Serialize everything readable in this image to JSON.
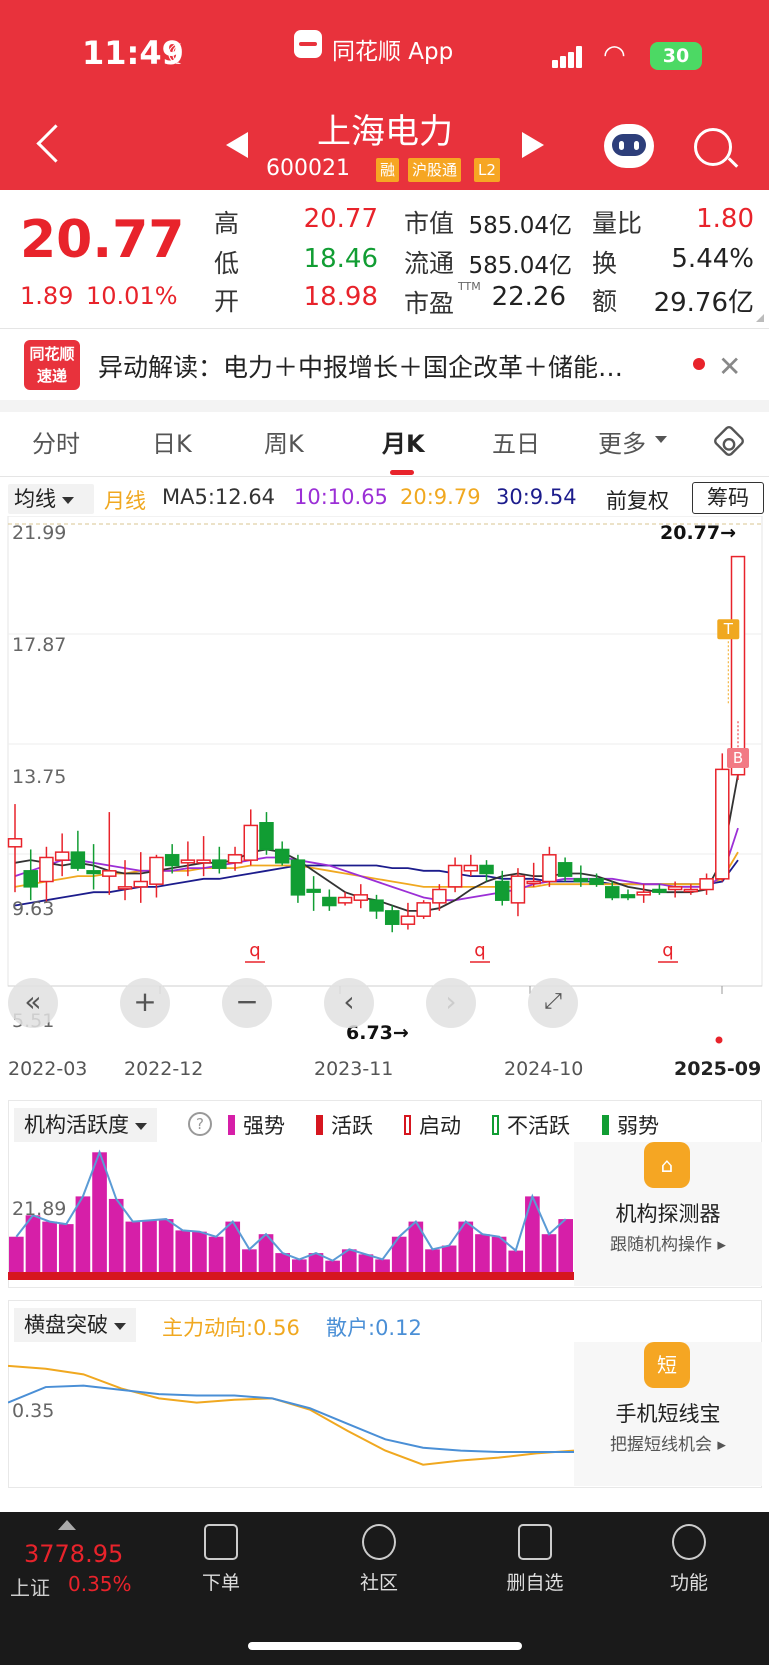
{
  "status_bar": {
    "time": "11:49",
    "app": "同花顺 App",
    "battery": "30"
  },
  "header": {
    "name": "上海电力",
    "code": "600021",
    "tags": [
      "融",
      "沪股通",
      "L2"
    ]
  },
  "quote": {
    "price": "20.77",
    "change": "1.89",
    "change_pct": "10.01%",
    "high_label": "高",
    "high": "20.77",
    "low_label": "低",
    "low": "18.46",
    "open_label": "开",
    "open": "18.98",
    "mcap_label": "市值",
    "mcap": "585.04亿",
    "float_label": "流通",
    "float": "585.04亿",
    "pe_label": "市盈",
    "pe_sup": "TTM",
    "pe": "22.26",
    "vr_label": "量比",
    "vr": "1.80",
    "turn_label": "换",
    "turn": "5.44%",
    "amt_label": "额",
    "amt": "29.76亿"
  },
  "news": {
    "logo_top": "同花顺",
    "logo_bottom": "速递",
    "text": "异动解读：电力＋中报增长＋国企改革＋储能…"
  },
  "tabs": [
    "分时",
    "日K",
    "周K",
    "月K",
    "五日",
    "更多"
  ],
  "ma_bar": {
    "dropdown": "均线",
    "period": "月线",
    "ma5": "MA5:12.64",
    "ma10": "10:10.65",
    "ma20": "20:9.79",
    "ma30": "30:9.54",
    "adjust": "前复权",
    "chip": "筹码"
  },
  "colors": {
    "up": "#e8232b",
    "down": "#119d33",
    "ma5": "#333333",
    "ma10": "#9b2fd6",
    "ma20": "#f0a820",
    "ma30": "#1c1c8c"
  },
  "chart_data": {
    "type": "candlestick",
    "y_ticks": [
      "21.99",
      "17.87",
      "13.75",
      "9.63",
      "5.51"
    ],
    "ylim": [
      5.51,
      21.99
    ],
    "x_ticks": [
      "2022-03",
      "2022-12",
      "2023-11",
      "2024-10",
      "2025-09"
    ],
    "max_label": "20.77→",
    "min_label": "6.73→",
    "markers": {
      "t": "T",
      "b": "B",
      "q": "q"
    },
    "candles": [
      [
        9.9,
        11.5,
        8.2,
        10.2
      ],
      [
        9.0,
        9.8,
        7.9,
        8.4
      ],
      [
        8.6,
        9.9,
        7.8,
        9.5
      ],
      [
        9.4,
        10.4,
        8.8,
        9.7
      ],
      [
        9.7,
        10.5,
        9.0,
        9.1
      ],
      [
        9.0,
        10.0,
        8.3,
        8.9
      ],
      [
        8.8,
        11.2,
        8.1,
        9.0
      ],
      [
        8.4,
        9.4,
        7.9,
        8.4
      ],
      [
        8.4,
        9.7,
        7.8,
        8.6
      ],
      [
        8.5,
        9.6,
        8.0,
        9.5
      ],
      [
        9.6,
        10.0,
        8.9,
        9.2
      ],
      [
        9.3,
        10.1,
        8.8,
        9.4
      ],
      [
        9.3,
        10.3,
        8.8,
        9.4
      ],
      [
        9.4,
        9.9,
        8.9,
        9.1
      ],
      [
        9.3,
        9.9,
        9.0,
        9.6
      ],
      [
        9.4,
        11.3,
        9.2,
        10.7
      ],
      [
        10.8,
        11.2,
        9.6,
        9.8
      ],
      [
        9.8,
        10.1,
        9.2,
        9.3
      ],
      [
        9.4,
        9.6,
        7.8,
        8.1
      ],
      [
        8.3,
        8.8,
        7.5,
        8.2
      ],
      [
        8.0,
        8.3,
        7.5,
        7.7
      ],
      [
        7.8,
        8.2,
        7.7,
        8.0
      ],
      [
        7.9,
        8.5,
        7.6,
        8.1
      ],
      [
        7.9,
        8.1,
        7.2,
        7.5
      ],
      [
        7.5,
        7.7,
        6.7,
        7.0
      ],
      [
        7.0,
        7.8,
        6.8,
        7.3
      ],
      [
        7.3,
        7.9,
        7.2,
        7.8
      ],
      [
        7.8,
        8.5,
        7.5,
        8.3
      ],
      [
        8.4,
        9.5,
        8.2,
        9.2
      ],
      [
        9.0,
        9.6,
        8.8,
        9.2
      ],
      [
        9.2,
        9.4,
        8.6,
        8.9
      ],
      [
        8.6,
        9.0,
        7.7,
        7.9
      ],
      [
        7.8,
        9.1,
        7.3,
        8.8
      ],
      [
        8.6,
        9.3,
        8.4,
        8.6
      ],
      [
        8.6,
        9.9,
        8.4,
        9.6
      ],
      [
        9.3,
        9.5,
        8.6,
        8.8
      ],
      [
        8.7,
        9.2,
        8.4,
        8.6
      ],
      [
        8.7,
        8.9,
        8.4,
        8.5
      ],
      [
        8.4,
        8.6,
        7.9,
        8.0
      ],
      [
        8.1,
        8.3,
        7.9,
        8.0
      ],
      [
        8.1,
        8.5,
        7.8,
        8.2
      ],
      [
        8.3,
        8.5,
        8.1,
        8.2
      ],
      [
        8.3,
        8.6,
        8.0,
        8.4
      ],
      [
        8.3,
        8.5,
        8.1,
        8.3
      ],
      [
        8.3,
        8.9,
        8.1,
        8.7
      ],
      [
        8.7,
        13.4,
        8.6,
        12.8
      ],
      [
        12.6,
        20.77,
        12.4,
        20.77
      ]
    ],
    "ma5": [
      9.3,
      9.4,
      9.3,
      9.2,
      9.3,
      9.2,
      9.0,
      8.9,
      8.9,
      9.0,
      9.1,
      9.2,
      9.3,
      9.3,
      9.4,
      9.7,
      9.8,
      9.7,
      9.4,
      9.0,
      8.6,
      8.2,
      8.0,
      7.9,
      7.7,
      7.5,
      7.5,
      7.6,
      7.9,
      8.3,
      8.6,
      8.8,
      8.9,
      8.8,
      8.8,
      8.9,
      8.9,
      8.8,
      8.6,
      8.4,
      8.3,
      8.2,
      8.2,
      8.2,
      8.3,
      9.4,
      12.6
    ],
    "ma10": [
      8.8,
      9.0,
      9.2,
      9.4,
      9.4,
      9.3,
      9.2,
      9.1,
      9.0,
      9.0,
      9.0,
      9.1,
      9.1,
      9.2,
      9.3,
      9.4,
      9.5,
      9.5,
      9.4,
      9.3,
      9.2,
      9.0,
      8.8,
      8.6,
      8.4,
      8.2,
      8.0,
      7.9,
      7.9,
      8.0,
      8.1,
      8.2,
      8.3,
      8.5,
      8.6,
      8.7,
      8.7,
      8.7,
      8.7,
      8.6,
      8.5,
      8.5,
      8.4,
      8.4,
      8.4,
      8.8,
      10.6
    ],
    "ma20": [
      8.4,
      8.5,
      8.6,
      8.7,
      8.8,
      8.8,
      8.9,
      8.9,
      9.0,
      9.0,
      9.0,
      9.0,
      9.1,
      9.1,
      9.1,
      9.2,
      9.2,
      9.2,
      9.2,
      9.1,
      9.0,
      8.9,
      8.8,
      8.7,
      8.6,
      8.5,
      8.4,
      8.4,
      8.4,
      8.4,
      8.4,
      8.4,
      8.4,
      8.4,
      8.5,
      8.5,
      8.5,
      8.5,
      8.5,
      8.5,
      8.5,
      8.5,
      8.5,
      8.5,
      8.5,
      8.7,
      9.7
    ],
    "ma30": [
      7.7,
      7.8,
      7.9,
      8.0,
      8.1,
      8.2,
      8.2,
      8.3,
      8.4,
      8.4,
      8.5,
      8.6,
      8.7,
      8.7,
      8.8,
      8.9,
      9.0,
      9.1,
      9.2,
      9.2,
      9.2,
      9.2,
      9.2,
      9.2,
      9.1,
      9.1,
      9.0,
      9.0,
      8.9,
      8.8,
      8.8,
      8.7,
      8.7,
      8.7,
      8.6,
      8.6,
      8.6,
      8.6,
      8.5,
      8.5,
      8.5,
      8.5,
      8.5,
      8.5,
      8.5,
      8.6,
      9.4
    ]
  },
  "activity": {
    "dropdown": "机构活跃度",
    "help": "?",
    "legend": [
      {
        "label": "强势",
        "color": "#d61fa8",
        "style": "solid"
      },
      {
        "label": "活跃",
        "color": "#d6161f",
        "style": "solid"
      },
      {
        "label": "启动",
        "color": "#d6161f",
        "style": "outline"
      },
      {
        "label": "不活跃",
        "color": "#119d33",
        "style": "outline"
      },
      {
        "label": "弱势",
        "color": "#119d33",
        "style": "solid"
      }
    ],
    "y_tick": "21.89",
    "values": [
      28,
      45,
      40,
      38,
      60,
      95,
      58,
      40,
      41,
      42,
      33,
      32,
      28,
      40,
      18,
      30,
      15,
      10,
      15,
      9,
      18,
      14,
      10,
      28,
      40,
      18,
      21,
      40,
      30,
      28,
      17,
      60,
      30,
      42
    ],
    "card_icon": "⌂",
    "card_title": "机构探测器",
    "card_sub": "跟随机构操作 ▸"
  },
  "breakout": {
    "dropdown": "横盘突破",
    "main": "主力动向:0.56",
    "retail": "散户:0.12",
    "y_tick": "0.35",
    "main_values": [
      0.78,
      0.76,
      0.72,
      0.62,
      0.55,
      0.52,
      0.54,
      0.55,
      0.47,
      0.32,
      0.18,
      0.08,
      0.11,
      0.13,
      0.16,
      0.18
    ],
    "retail_values": [
      0.52,
      0.63,
      0.64,
      0.61,
      0.58,
      0.57,
      0.57,
      0.55,
      0.48,
      0.37,
      0.26,
      0.2,
      0.18,
      0.17,
      0.17,
      0.17
    ],
    "card_icon": "短",
    "card_title": "手机短线宝",
    "card_sub": "把握短线机会 ▸"
  },
  "bottom_bar": {
    "index_value": "3778.95",
    "index_name": "上证",
    "index_pct": "0.35%",
    "items": [
      "下单",
      "社区",
      "删自选",
      "功能"
    ]
  }
}
